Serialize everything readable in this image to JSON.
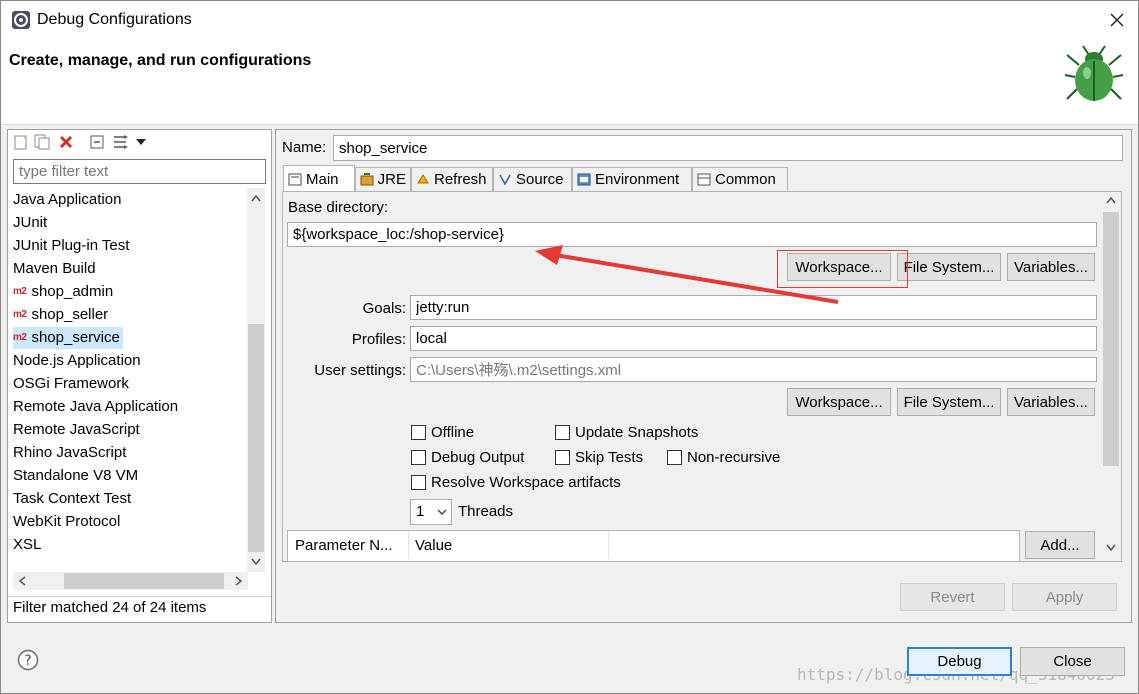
{
  "window": {
    "title": "Debug Configurations"
  },
  "banner": {
    "title": "Create, manage, and run configurations"
  },
  "filter": {
    "placeholder": "type filter text",
    "status": "Filter matched 24 of 24 items"
  },
  "tree": {
    "items": [
      {
        "label": "Java Application",
        "m2": false
      },
      {
        "label": "JUnit",
        "m2": false
      },
      {
        "label": "JUnit Plug-in Test",
        "m2": false
      },
      {
        "label": "Maven Build",
        "m2": false
      },
      {
        "label": "shop_admin",
        "m2": true
      },
      {
        "label": "shop_seller",
        "m2": true
      },
      {
        "label": "shop_service",
        "m2": true,
        "selected": true
      },
      {
        "label": "Node.js Application",
        "m2": false
      },
      {
        "label": "OSGi Framework",
        "m2": false
      },
      {
        "label": "Remote Java Application",
        "m2": false
      },
      {
        "label": "Remote JavaScript",
        "m2": false
      },
      {
        "label": "Rhino JavaScript",
        "m2": false
      },
      {
        "label": "Standalone V8 VM",
        "m2": false
      },
      {
        "label": "Task Context Test",
        "m2": false
      },
      {
        "label": "WebKit Protocol",
        "m2": false
      },
      {
        "label": "XSL",
        "m2": false
      }
    ],
    "m2_badge": "m2"
  },
  "config": {
    "name_label": "Name:",
    "name_value": "shop_service"
  },
  "tabs": [
    {
      "label": "Main"
    },
    {
      "label": "JRE"
    },
    {
      "label": "Refresh"
    },
    {
      "label": "Source"
    },
    {
      "label": "Environment"
    },
    {
      "label": "Common"
    }
  ],
  "main": {
    "base_dir_label": "Base directory:",
    "base_dir_value": "${workspace_loc:/shop-service}",
    "base_dir_buttons": {
      "workspace": "Workspace...",
      "filesystem": "File System...",
      "variables": "Variables..."
    },
    "goals_label": "Goals:",
    "goals_value": "jetty:run",
    "profiles_label": "Profiles:",
    "profiles_value": "local",
    "user_settings_label": "User settings:",
    "user_settings_value": "C:\\Users\\神殇\\.m2\\settings.xml",
    "settings_buttons": {
      "workspace": "Workspace...",
      "filesystem": "File System...",
      "variables": "Variables..."
    },
    "checkboxes": {
      "offline": "Offline",
      "update_snapshots": "Update Snapshots",
      "debug_output": "Debug Output",
      "skip_tests": "Skip Tests",
      "non_recursive": "Non-recursive",
      "resolve_workspace": "Resolve Workspace artifacts"
    },
    "threads_value": "1",
    "threads_label": "Threads",
    "param_columns": [
      "Parameter N...",
      "Value"
    ],
    "add_button": "Add..."
  },
  "actions": {
    "revert": "Revert",
    "apply": "Apply",
    "debug": "Debug",
    "close": "Close"
  },
  "watermark": "https://blog.csdn.net/qq_31840023",
  "colors": {
    "accent": "#2f7fd6",
    "arrow": "#e53935",
    "selection": "#cce8ff",
    "m2_badge": "#c62828"
  }
}
